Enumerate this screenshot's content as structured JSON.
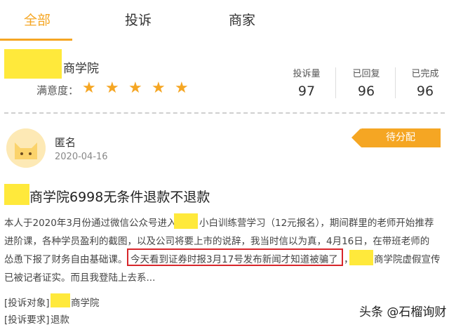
{
  "tabs": {
    "all": "全部",
    "complaint": "投诉",
    "merchant": "商家"
  },
  "merchant": {
    "name_suffix": "商学院",
    "rating_label": "满意度：",
    "stars": 5
  },
  "stats": [
    {
      "label": "投诉量",
      "value": "97"
    },
    {
      "label": "已回复",
      "value": "96"
    },
    {
      "label": "已完成",
      "value": "96"
    }
  ],
  "post": {
    "author": "匿名",
    "date": "2020-04-16",
    "status": "待分配",
    "title": "商学院6998无条件退款不退款",
    "body_line1_a": "本人于2020年3月份通过微信公众号进入",
    "body_line1_b": "小白训练营学习（12元报名），期间群里的老师开始推荐",
    "body_line2": "进阶课，各种学员盈利的截图，以及公司将要上市的说辞，我当时信以为真，4月16日，在带班老师的",
    "body_line3_a": "怂恿下报了财务自由基础课。",
    "body_line3_b": "今天看到证券时报3月17号发布新闻才知道被骗了",
    "body_line3_c": "，",
    "body_line3_d": "商学院虚假宣传",
    "body_line4": "已被记者证实。而且我登陆上去系...",
    "target_label": "[投诉对象]",
    "target_value": "商学院",
    "request_label": "[投诉要求]",
    "request_value": "退款"
  },
  "watermark": "头条 @石榴询财",
  "colors": {
    "accent": "#f5a623",
    "redaction": "#ffe93b",
    "highlight_border": "#d7262b"
  }
}
